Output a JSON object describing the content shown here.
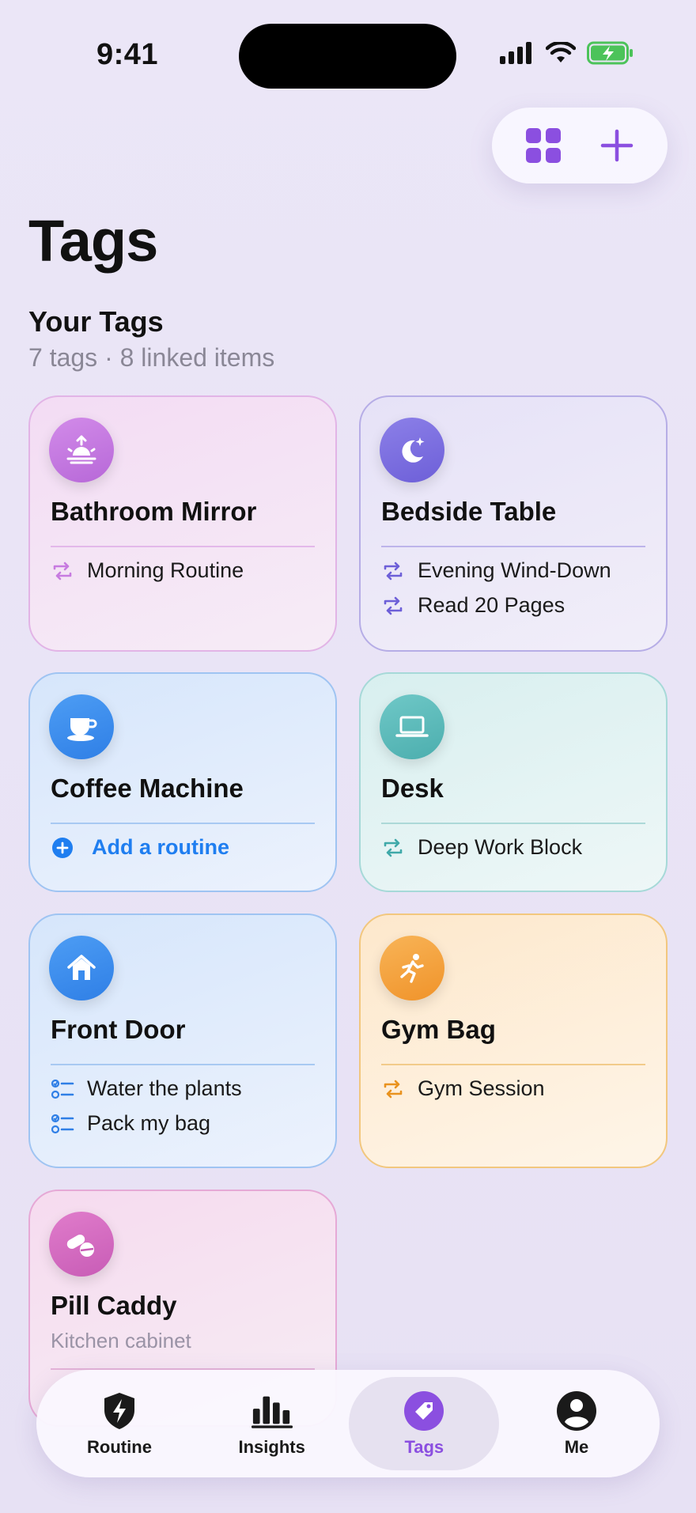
{
  "status": {
    "time": "9:41"
  },
  "page": {
    "title": "Tags"
  },
  "section": {
    "title": "Your Tags",
    "subtitle": "7 tags · 8 linked items"
  },
  "cards": [
    {
      "title": "Bathroom Mirror",
      "icon": "sunrise-icon",
      "accent": "#c77be0",
      "items": [
        {
          "type": "routine",
          "label": "Morning Routine"
        }
      ]
    },
    {
      "title": "Bedside Table",
      "icon": "moon-stars-icon",
      "accent": "#7b6de0",
      "items": [
        {
          "type": "routine",
          "label": "Evening Wind-Down"
        },
        {
          "type": "routine",
          "label": "Read 20 Pages"
        }
      ]
    },
    {
      "title": "Coffee Machine",
      "icon": "coffee-cup-icon",
      "accent": "#3b8ef0",
      "items": [
        {
          "type": "add",
          "label": "Add a routine"
        }
      ]
    },
    {
      "title": "Desk",
      "icon": "laptop-icon",
      "accent": "#52b8b8",
      "items": [
        {
          "type": "routine",
          "label": "Deep Work Block"
        }
      ]
    },
    {
      "title": "Front Door",
      "icon": "house-icon",
      "accent": "#3b8ef0",
      "items": [
        {
          "type": "checklist",
          "label": "Water the plants"
        },
        {
          "type": "checklist",
          "label": "Pack my bag"
        }
      ]
    },
    {
      "title": "Gym Bag",
      "icon": "running-figure-icon",
      "accent": "#f3a23a",
      "items": [
        {
          "type": "routine",
          "label": "Gym Session"
        }
      ]
    },
    {
      "title": "Pill Caddy",
      "subtitle": "Kitchen cabinet",
      "icon": "pills-icon",
      "accent": "#d76bc0",
      "items": []
    }
  ],
  "tabbar": {
    "tabs": [
      {
        "label": "Routine",
        "icon": "bolt-shield-icon",
        "active": false
      },
      {
        "label": "Insights",
        "icon": "bar-chart-icon",
        "active": false
      },
      {
        "label": "Tags",
        "icon": "tag-icon",
        "active": true
      },
      {
        "label": "Me",
        "icon": "person-circle-icon",
        "active": false
      }
    ]
  }
}
